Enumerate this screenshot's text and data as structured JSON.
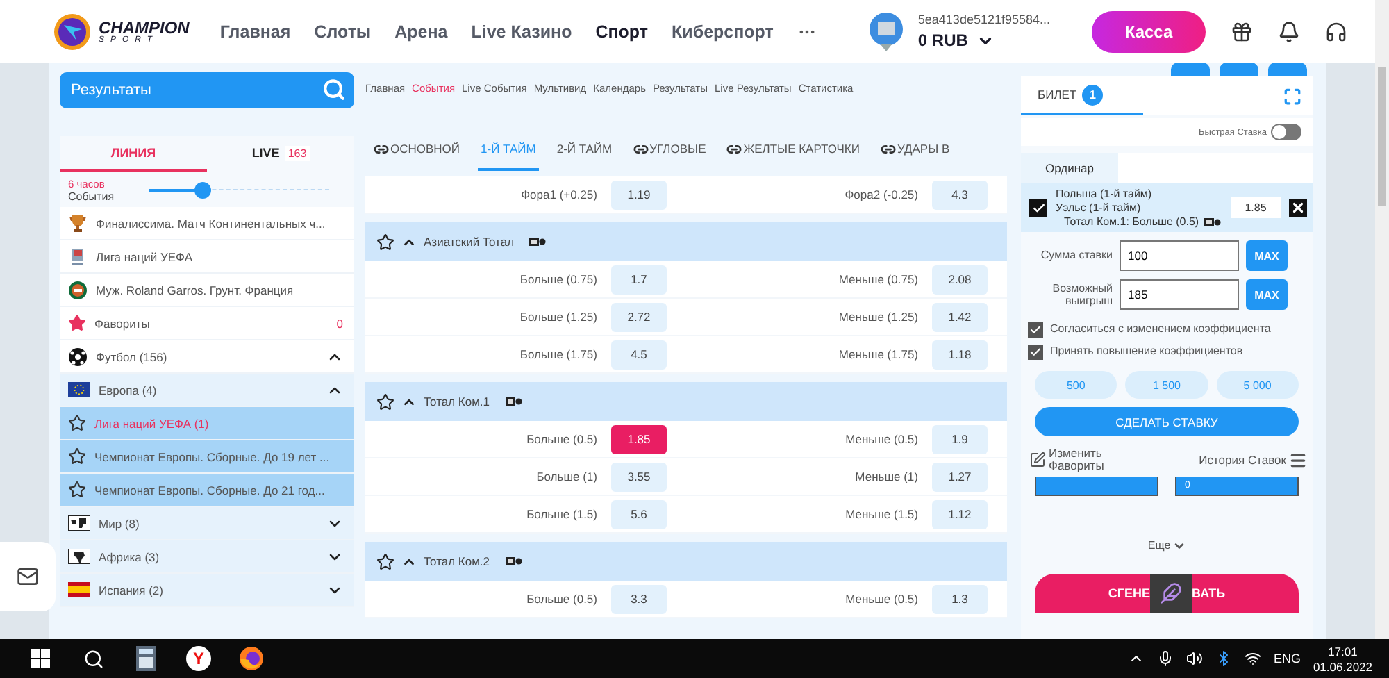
{
  "header": {
    "logo": {
      "title": "CHAMPION",
      "subtitle": "SPORT"
    },
    "nav": [
      {
        "label": "Главная",
        "selected": false
      },
      {
        "label": "Слоты",
        "selected": false
      },
      {
        "label": "Арена",
        "selected": false
      },
      {
        "label": "Live Казино",
        "selected": false
      },
      {
        "label": "Спорт",
        "selected": true
      },
      {
        "label": "Киберспорт",
        "selected": false
      }
    ],
    "account": {
      "id": "5ea413de5121f95584...",
      "balance": "0 RUB"
    },
    "cashier_button": "Касса"
  },
  "sidebar": {
    "search": {
      "value": "Результаты"
    },
    "tabs": [
      {
        "label": "ЛИНИЯ",
        "selected": true
      },
      {
        "label": "LIVE",
        "count": "163",
        "selected": false
      }
    ],
    "filter": {
      "period": "6 часов",
      "label": "События",
      "level": 0.3
    },
    "items": [
      {
        "kind": "trophy",
        "label": "Финалиссима. Матч Континентальных ч..."
      },
      {
        "kind": "league",
        "label": "Лига наций УЕФА"
      },
      {
        "kind": "clay",
        "label": "Муж. Roland Garros. Грунт. Франция"
      },
      {
        "kind": "favorites",
        "label": "Фавориты",
        "count": "0"
      },
      {
        "kind": "sport",
        "label": "Футбол (156)",
        "expanded": true,
        "children": [
          {
            "kind": "europe",
            "label": "Европа (4)",
            "expanded": true,
            "children": [
              {
                "kind": "tournament",
                "label": "Лига наций УЕФА (1)",
                "selected": true
              },
              {
                "kind": "tournament",
                "label": "Чемпионат Европы. Сборные. До 19 лет ...",
                "selected": false
              },
              {
                "kind": "tournament",
                "label": "Чемпионат Европы. Сборные. До 21 год...",
                "selected": false
              }
            ]
          },
          {
            "kind": "world",
            "label": "Мир (8)",
            "expanded": false
          },
          {
            "kind": "africa",
            "label": "Африка (3)",
            "expanded": false
          },
          {
            "kind": "spain",
            "label": "Испания (2)",
            "expanded": false
          }
        ]
      }
    ]
  },
  "content": {
    "breadcrumbs": [
      {
        "label": "Главная",
        "selected": false
      },
      {
        "label": "События",
        "selected": true
      },
      {
        "label": "Live События",
        "selected": false
      },
      {
        "label": "Мультивид",
        "selected": false
      },
      {
        "label": "Календарь",
        "selected": false
      },
      {
        "label": "Результаты",
        "selected": false
      },
      {
        "label": "Live Результаты",
        "selected": false
      },
      {
        "label": "Статистика",
        "selected": false
      }
    ],
    "market_tabs": [
      {
        "label": "ОСНОВНОЙ",
        "linked": true,
        "selected": false
      },
      {
        "label": "1-Й ТАЙМ",
        "linked": false,
        "selected": true
      },
      {
        "label": "2-Й ТАЙМ",
        "linked": false,
        "selected": false
      },
      {
        "label": "УГЛОВЫЕ",
        "linked": true,
        "selected": false
      },
      {
        "label": "ЖЕЛТЫЕ КАРТОЧКИ",
        "linked": true,
        "selected": false
      },
      {
        "label": "УДАРЫ В",
        "linked": true,
        "selected": false
      }
    ],
    "markets": [
      {
        "rows": [
          {
            "left": {
              "label": "Фора1 (+0.25)",
              "odds": "1.19",
              "selected": false
            },
            "right": {
              "label": "Фора2 (-0.25)",
              "odds": "4.3",
              "selected": false
            }
          }
        ]
      },
      {
        "title": "Азиатский Тотал",
        "rows": [
          {
            "left": {
              "label": "Больше (0.75)",
              "odds": "1.7",
              "selected": false
            },
            "right": {
              "label": "Меньше (0.75)",
              "odds": "2.08",
              "selected": false
            }
          },
          {
            "left": {
              "label": "Больше (1.25)",
              "odds": "2.72",
              "selected": false
            },
            "right": {
              "label": "Меньше (1.25)",
              "odds": "1.42",
              "selected": false
            }
          },
          {
            "left": {
              "label": "Больше (1.75)",
              "odds": "4.5",
              "selected": false
            },
            "right": {
              "label": "Меньше (1.75)",
              "odds": "1.18",
              "selected": false
            }
          }
        ]
      },
      {
        "title": "Тотал Ком.1",
        "rows": [
          {
            "left": {
              "label": "Больше (0.5)",
              "odds": "1.85",
              "selected": true
            },
            "right": {
              "label": "Меньше (0.5)",
              "odds": "1.9",
              "selected": false
            }
          },
          {
            "left": {
              "label": "Больше (1)",
              "odds": "3.55",
              "selected": false
            },
            "right": {
              "label": "Меньше (1)",
              "odds": "1.27",
              "selected": false
            }
          },
          {
            "left": {
              "label": "Больше (1.5)",
              "odds": "5.6",
              "selected": false
            },
            "right": {
              "label": "Меньше (1.5)",
              "odds": "1.12",
              "selected": false
            }
          }
        ]
      },
      {
        "title": "Тотал Ком.2",
        "rows": [
          {
            "left": {
              "label": "Больше (0.5)",
              "odds": "3.3",
              "selected": false
            },
            "right": {
              "label": "Меньше (0.5)",
              "odds": "1.3",
              "selected": false
            }
          }
        ]
      }
    ]
  },
  "betslip": {
    "tabs": [
      {
        "label": "БИЛЕТ",
        "count": "1",
        "selected": true
      }
    ],
    "quick_bet": {
      "label": "Быстрая Ставка",
      "on": false
    },
    "bet_types": [
      {
        "label": "Ординар",
        "selected": true
      }
    ],
    "selections": [
      {
        "checked": true,
        "team1": "Польша (1-й тайм)",
        "team2": "Уэльс (1-й тайм)",
        "odds": "1.85",
        "market": "Тотал Ком.1: Больше (0.5)"
      }
    ],
    "stake": {
      "label": "Сумма ставки",
      "value": "100",
      "max": "MAX"
    },
    "win": {
      "label": "Возможный выигрыш",
      "value": "185",
      "max": "MAX"
    },
    "options": [
      {
        "label": "Согласиться с изменением коэффициента",
        "checked": true
      },
      {
        "label": "Принять повышение коэффициентов",
        "checked": true
      }
    ],
    "quick_amounts": [
      "500",
      "1 500",
      "5 000"
    ],
    "place_bet": "СДЕЛАТЬ СТАВКУ",
    "edit_favorites": "Изменить Фавориты",
    "history": "История Ставок",
    "partial_fields": [
      {
        "kind": "field"
      },
      {
        "kind": "field",
        "value": "0"
      }
    ],
    "more": "Еще",
    "generate": {
      "left": "СГЕНЕ",
      "right": "ВАТЬ"
    }
  },
  "taskbar": {
    "apps": [
      {
        "kind": "search"
      },
      {
        "kind": "calculator"
      },
      {
        "kind": "yandex",
        "letter": "Y"
      },
      {
        "kind": "firefox"
      }
    ],
    "language": "ENG",
    "time": "17:01",
    "date": "01.06.2022"
  }
}
